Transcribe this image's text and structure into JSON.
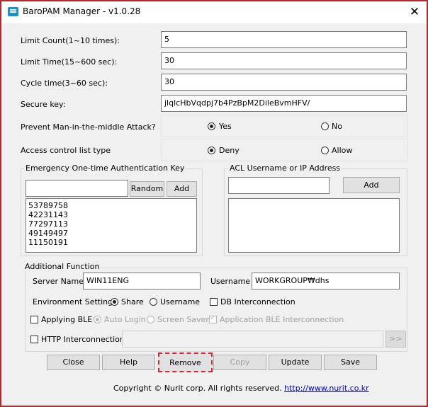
{
  "window": {
    "title": "BaroPAM Manager - v1.0.28",
    "close_glyph": "✕"
  },
  "settings": {
    "limit_count": {
      "label": "Limit Count(1~10 times):",
      "value": "5"
    },
    "limit_time": {
      "label": "Limit Time(15~600 sec):",
      "value": "30"
    },
    "cycle_time": {
      "label": "Cycle time(3~60 sec):",
      "value": "30"
    },
    "secure_key": {
      "label": "Secure key:",
      "value": "jlqlcHbVqdpj7b4PzBpM2DileBvmHFV/"
    }
  },
  "mitm": {
    "label": "Prevent Man-in-the-middle Attack?",
    "yes": "Yes",
    "no": "No",
    "selected": "Yes"
  },
  "acl_type": {
    "label": "Access control list type",
    "deny": "Deny",
    "allow": "Allow",
    "selected": "Deny"
  },
  "emergency": {
    "title": "Emergency One-time Authentication Key",
    "input_value": "",
    "random_label": "Random",
    "add_label": "Add",
    "keys": [
      "53789758",
      "42231143",
      "77297113",
      "49149497",
      "11150191"
    ]
  },
  "acl_list": {
    "title": "ACL Username or IP Address",
    "input_value": "",
    "add_label": "Add"
  },
  "additional": {
    "title": "Additional Function",
    "server_name_label": "Server Name",
    "server_name_value": "WIN11ENG",
    "username_label": "Username",
    "username_value": "WORKGROUP₩dhs",
    "env_label": "Environment Setting",
    "env_share": "Share",
    "env_username": "Username",
    "env_selected": "Share",
    "db_interconnection": "DB Interconnection",
    "applying_ble": "Applying BLE",
    "auto_login": "Auto Login",
    "screen_saver": "Screen Saver",
    "app_ble": "Application BLE Interconnection",
    "http_interconnection": "HTTP Interconnection",
    "http_value": "",
    "arrow_label": ">>"
  },
  "buttons": {
    "close": "Close",
    "help": "Help",
    "remove": "Remove",
    "copy": "Copy",
    "update": "Update",
    "save": "Save"
  },
  "footer": {
    "copyright": "Copyright © Nurit corp. All rights reserved.",
    "url": "http://www.nurit.co.kr"
  },
  "colors": {
    "accent_border": "#b02a2f",
    "highlight_dashed": "#d9262c",
    "link": "#0000ee"
  }
}
